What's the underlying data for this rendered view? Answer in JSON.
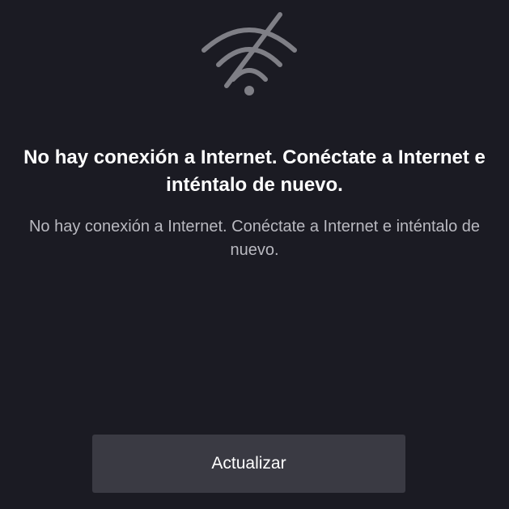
{
  "status": {
    "title": "No hay conexión a Internet. Conéctate a Internet e inténtalo de nuevo.",
    "message": "No hay conexión a Internet. Conéctate a Internet e inténtalo de nuevo."
  },
  "actions": {
    "refresh_label": "Actualizar"
  },
  "icons": {
    "status_icon": "wifi-off-icon"
  },
  "colors": {
    "background": "#1b1b23",
    "title": "#ffffff",
    "message": "#b9b9c0",
    "button_background": "#3a3a43",
    "icon": "#7f7f86"
  }
}
